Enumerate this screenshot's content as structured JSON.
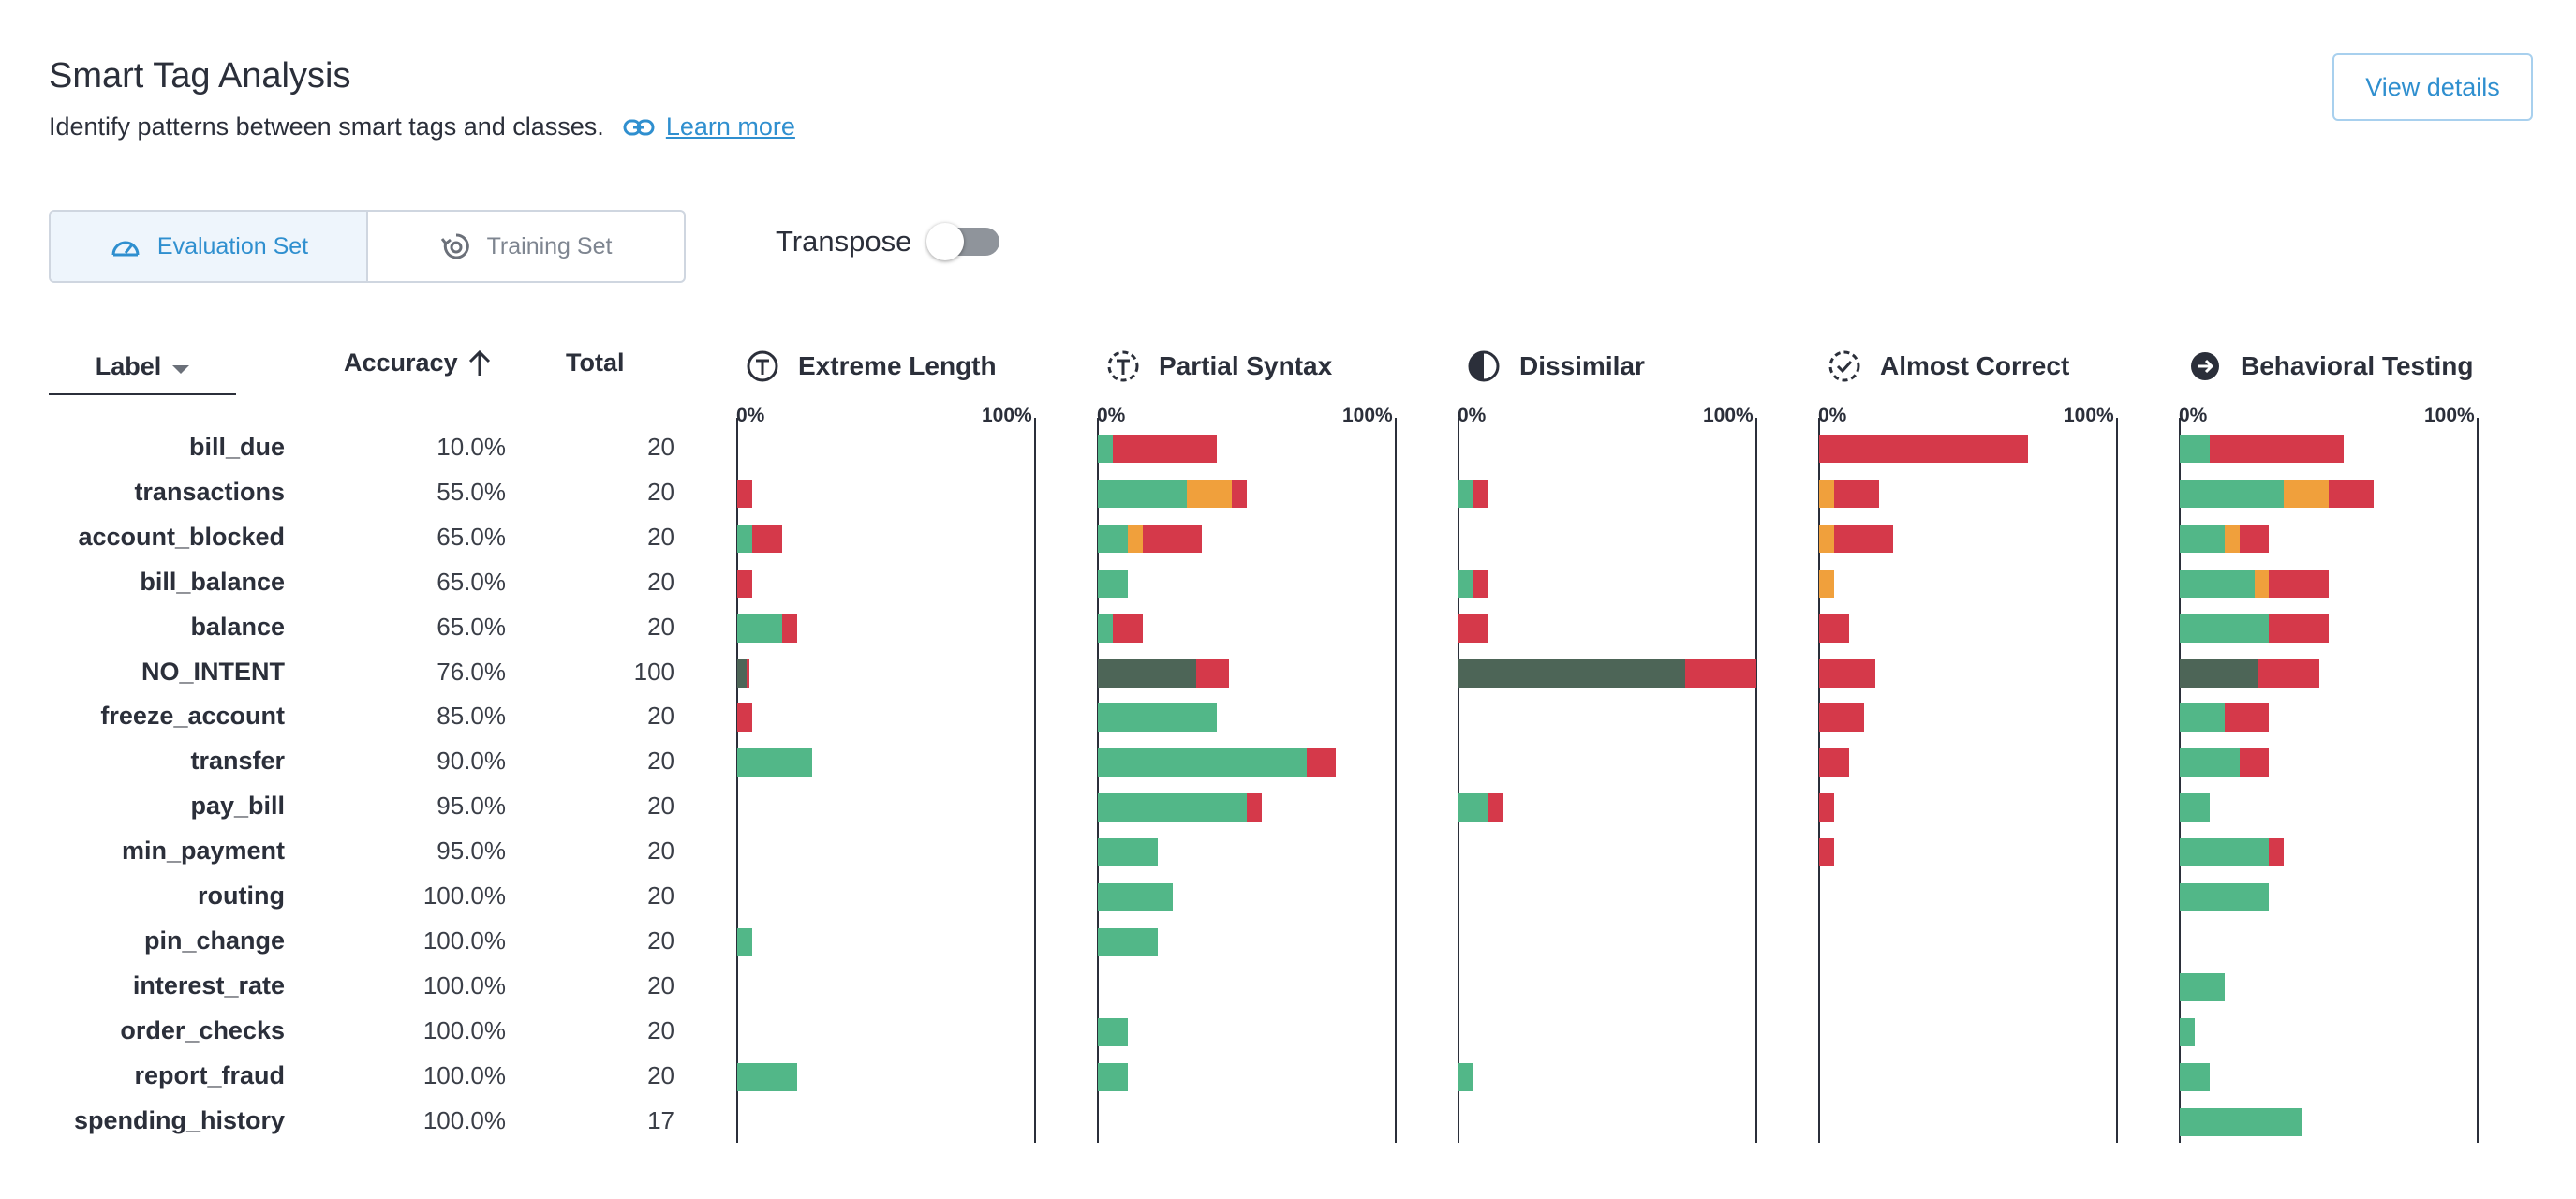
{
  "header": {
    "title": "Smart Tag Analysis",
    "subtitle": "Identify patterns between smart tags and classes.",
    "learn_more": "Learn more",
    "view_details": "View details"
  },
  "dataset_toggle": {
    "options": [
      "Evaluation Set",
      "Training Set"
    ],
    "selected": "Evaluation Set"
  },
  "transpose": {
    "label": "Transpose",
    "on": false
  },
  "columns": {
    "label": "Label",
    "accuracy": "Accuracy",
    "total": "Total"
  },
  "axis_labels": {
    "min": "0%",
    "max": "100%"
  },
  "colors": {
    "correct": "#52b788",
    "almost": "#f0a03c",
    "wrong": "#d5394a",
    "no_intent": "#4d6557",
    "accent": "#2f8fcf"
  },
  "rows": [
    {
      "label": "bill_due",
      "accuracy": "10.0%",
      "total": "20"
    },
    {
      "label": "transactions",
      "accuracy": "55.0%",
      "total": "20"
    },
    {
      "label": "account_blocked",
      "accuracy": "65.0%",
      "total": "20"
    },
    {
      "label": "bill_balance",
      "accuracy": "65.0%",
      "total": "20"
    },
    {
      "label": "balance",
      "accuracy": "65.0%",
      "total": "20"
    },
    {
      "label": "NO_INTENT",
      "accuracy": "76.0%",
      "total": "100"
    },
    {
      "label": "freeze_account",
      "accuracy": "85.0%",
      "total": "20"
    },
    {
      "label": "transfer",
      "accuracy": "90.0%",
      "total": "20"
    },
    {
      "label": "pay_bill",
      "accuracy": "95.0%",
      "total": "20"
    },
    {
      "label": "min_payment",
      "accuracy": "95.0%",
      "total": "20"
    },
    {
      "label": "routing",
      "accuracy": "100.0%",
      "total": "20"
    },
    {
      "label": "pin_change",
      "accuracy": "100.0%",
      "total": "20"
    },
    {
      "label": "interest_rate",
      "accuracy": "100.0%",
      "total": "20"
    },
    {
      "label": "order_checks",
      "accuracy": "100.0%",
      "total": "20"
    },
    {
      "label": "report_fraud",
      "accuracy": "100.0%",
      "total": "20"
    },
    {
      "label": "spending_history",
      "accuracy": "100.0%",
      "total": "17"
    }
  ],
  "chart_data": {
    "type": "bar",
    "orientation": "horizontal",
    "stacked": true,
    "xlim": [
      0,
      100
    ],
    "categories": [
      "bill_due",
      "transactions",
      "account_blocked",
      "bill_balance",
      "balance",
      "NO_INTENT",
      "freeze_account",
      "transfer",
      "pay_bill",
      "min_payment",
      "routing",
      "pin_change",
      "interest_rate",
      "order_checks",
      "report_fraud",
      "spending_history"
    ],
    "tags": [
      {
        "name": "Extreme Length",
        "icon": "extreme-length-icon",
        "values": [
          [
            0,
            0,
            0
          ],
          [
            0,
            0,
            5
          ],
          [
            5,
            0,
            10
          ],
          [
            0,
            0,
            5
          ],
          [
            15,
            0,
            5
          ],
          [
            3,
            0,
            1
          ],
          [
            0,
            0,
            5
          ],
          [
            25,
            0,
            0
          ],
          [
            0,
            0,
            0
          ],
          [
            0,
            0,
            0
          ],
          [
            0,
            0,
            0
          ],
          [
            5,
            0,
            0
          ],
          [
            0,
            0,
            0
          ],
          [
            0,
            0,
            0
          ],
          [
            20,
            0,
            0
          ],
          [
            0,
            0,
            0
          ]
        ]
      },
      {
        "name": "Partial Syntax",
        "icon": "partial-syntax-icon",
        "values": [
          [
            5,
            0,
            35
          ],
          [
            30,
            15,
            5
          ],
          [
            10,
            5,
            20
          ],
          [
            10,
            0,
            0
          ],
          [
            5,
            0,
            10
          ],
          [
            33,
            0,
            11
          ],
          [
            40,
            0,
            0
          ],
          [
            70,
            0,
            10
          ],
          [
            50,
            0,
            5
          ],
          [
            20,
            0,
            0
          ],
          [
            25,
            0,
            0
          ],
          [
            20,
            0,
            0
          ],
          [
            0,
            0,
            0
          ],
          [
            10,
            0,
            0
          ],
          [
            10,
            0,
            0
          ],
          [
            0,
            0,
            0
          ]
        ]
      },
      {
        "name": "Dissimilar",
        "icon": "dissimilar-icon",
        "values": [
          [
            0,
            0,
            0
          ],
          [
            5,
            0,
            5
          ],
          [
            0,
            0,
            0
          ],
          [
            5,
            0,
            5
          ],
          [
            0,
            0,
            10
          ],
          [
            76,
            0,
            24
          ],
          [
            0,
            0,
            0
          ],
          [
            0,
            0,
            0
          ],
          [
            10,
            0,
            5
          ],
          [
            0,
            0,
            0
          ],
          [
            0,
            0,
            0
          ],
          [
            0,
            0,
            0
          ],
          [
            0,
            0,
            0
          ],
          [
            0,
            0,
            0
          ],
          [
            5,
            0,
            0
          ],
          [
            0,
            0,
            0
          ]
        ]
      },
      {
        "name": "Almost Correct",
        "icon": "almost-correct-icon",
        "values": [
          [
            0,
            0,
            70
          ],
          [
            0,
            5,
            15
          ],
          [
            0,
            5,
            20
          ],
          [
            0,
            5,
            0
          ],
          [
            0,
            0,
            10
          ],
          [
            0,
            0,
            19
          ],
          [
            0,
            0,
            15
          ],
          [
            0,
            0,
            10
          ],
          [
            0,
            0,
            5
          ],
          [
            0,
            0,
            5
          ],
          [
            0,
            0,
            0
          ],
          [
            0,
            0,
            0
          ],
          [
            0,
            0,
            0
          ],
          [
            0,
            0,
            0
          ],
          [
            0,
            0,
            0
          ],
          [
            0,
            0,
            0
          ]
        ]
      },
      {
        "name": "Behavioral Testing",
        "icon": "behavioral-testing-icon",
        "values": [
          [
            10,
            0,
            45
          ],
          [
            35,
            15,
            15
          ],
          [
            15,
            5,
            10
          ],
          [
            25,
            5,
            20
          ],
          [
            30,
            0,
            20
          ],
          [
            26,
            0,
            21
          ],
          [
            15,
            0,
            15
          ],
          [
            20,
            0,
            10
          ],
          [
            10,
            0,
            0
          ],
          [
            30,
            0,
            5
          ],
          [
            30,
            0,
            0
          ],
          [
            0,
            0,
            0
          ],
          [
            15,
            0,
            0
          ],
          [
            5,
            0,
            0
          ],
          [
            10,
            0,
            0
          ],
          [
            41,
            0,
            0
          ]
        ]
      }
    ],
    "segments": [
      "correct",
      "almost_correct",
      "incorrect"
    ],
    "dark_row": "NO_INTENT"
  }
}
